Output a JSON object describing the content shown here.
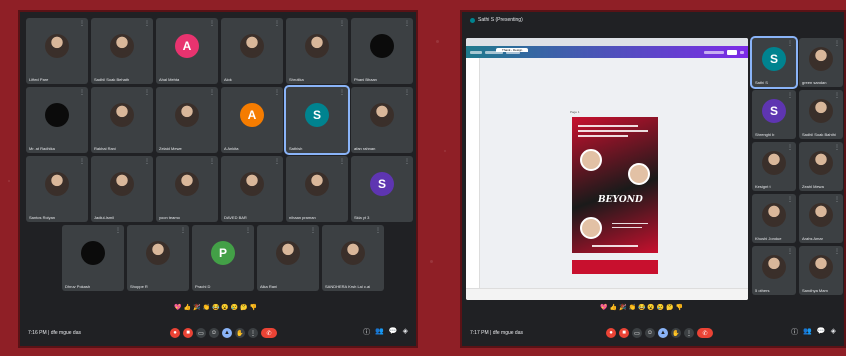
{
  "meeting_left": {
    "participants": [
      {
        "name": "Lifted Pare",
        "avatar": "photo"
      },
      {
        "name": "Sadhil Soak Behath",
        "avatar": "photo"
      },
      {
        "name": "Ahal Mehta",
        "avatar": "initial",
        "initial": "A",
        "color": "#e8336f"
      },
      {
        "name": "Alok",
        "avatar": "photo"
      },
      {
        "name": "Shrutika",
        "avatar": "photo"
      },
      {
        "name": "Phani Bhaan",
        "avatar": "dark"
      },
      {
        "name": "Mr. at Radhika",
        "avatar": "dark"
      },
      {
        "name": "Rakhai Rani",
        "avatar": "photo"
      },
      {
        "name": "Zelaid Mewe",
        "avatar": "photo"
      },
      {
        "name": "A Ankita",
        "avatar": "initial",
        "initial": "A",
        "color": "#f57c00"
      },
      {
        "name": "Sathish",
        "avatar": "initial",
        "initial": "S",
        "color": "#00838f",
        "active": true
      },
      {
        "name": "afan rahnan",
        "avatar": "photo"
      },
      {
        "name": "Santos Roiyan",
        "avatar": "photo"
      },
      {
        "name": "Jadiul-Ismil",
        "avatar": "photo"
      },
      {
        "name": "yoon teamo",
        "avatar": "photo"
      },
      {
        "name": "DAVED BAR",
        "avatar": "photo"
      },
      {
        "name": "nihaan praman",
        "avatar": "photo"
      },
      {
        "name": "Skla yt 3",
        "avatar": "initial",
        "initial": "S",
        "color": "#5e35b1"
      },
      {
        "name": "Dhruv Pokash",
        "avatar": "dark"
      },
      {
        "name": "Shoppe R",
        "avatar": "photo"
      },
      {
        "name": "Prachi D",
        "avatar": "initial",
        "initial": "P",
        "color": "#43a047"
      },
      {
        "name": "Alka Rani",
        "avatar": "photo"
      },
      {
        "name": "SANDHERA Krsh Lal c.ai",
        "avatar": "photo"
      }
    ],
    "time_meeting": "7:16 PM | dfe mgue das"
  },
  "meeting_right": {
    "presenter_title": "Sathi S (Presenting)",
    "browser_tab": "Thank - Design",
    "poster_word": "BEYOND",
    "page_label": "Page 1",
    "participants": [
      {
        "name": "Sathi S",
        "avatar": "initial",
        "initial": "S",
        "color": "#00838f",
        "active": true
      },
      {
        "name": "green sandan",
        "avatar": "photo"
      },
      {
        "name": "Shrenghi b",
        "avatar": "initial",
        "initial": "S",
        "color": "#5e35b1"
      },
      {
        "name": "Sadhil Soak Bahthi",
        "avatar": "photo"
      },
      {
        "name": "Kesignt t",
        "avatar": "photo"
      },
      {
        "name": "Zeahl Mewa",
        "avatar": "photo"
      },
      {
        "name": "Khushi Jondue",
        "avatar": "photo"
      },
      {
        "name": "Arahs Amar",
        "avatar": "photo"
      },
      {
        "name": "5 others",
        "avatar": "photo"
      },
      {
        "name": "Sandhya Mam",
        "avatar": "photo"
      }
    ],
    "time_meeting": "7:17 PM | dfe mgue das"
  },
  "icons": {
    "mic": "mic-icon",
    "camera": "camera-icon",
    "hand": "raise-hand-icon",
    "present": "present-icon",
    "more": "more-icon",
    "leave": "leave-call-icon",
    "info": "info-icon",
    "people": "people-icon",
    "chat": "chat-icon"
  },
  "colors": {
    "background": "#8f1f26",
    "meet_dark": "#202124",
    "tile": "#3c4043",
    "leave": "#ea4335",
    "accent": "#8ab4f8"
  }
}
